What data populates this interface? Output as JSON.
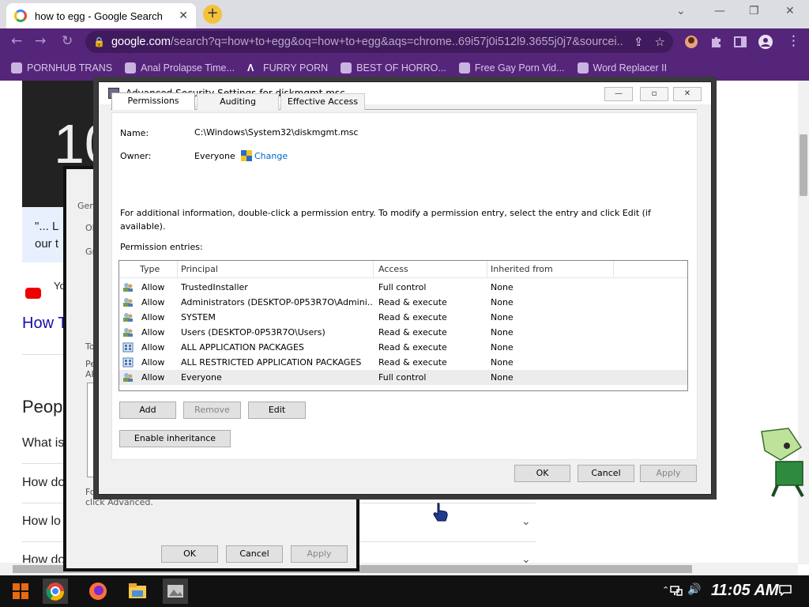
{
  "browser": {
    "tab_title": "how to egg - Google Search",
    "url_host": "google.com",
    "url_rest": "/search?q=how+to+egg&oq=how+to+egg&aqs=chrome..69i57j0i512l9.3655j0j7&sourcei...",
    "bookmarks": [
      "PORNHUB TRANS",
      "Anal Prolapse Time...",
      "FURRY PORN",
      "BEST OF HORRO...",
      "Free Gay Porn Vid...",
      "Word Replacer II"
    ]
  },
  "page": {
    "video_text": "10",
    "quote": "\"... L",
    "quote2": "our t",
    "yt_text": "Yo",
    "link": "How T",
    "people_heading": "Peop",
    "questions": [
      "What is",
      "How do",
      "How lo",
      "How do"
    ]
  },
  "bg_dialog": {
    "ghost_lines": [
      "Gen",
      "Ob",
      "Gro",
      "To",
      "Pe",
      "AP",
      "For",
      "click Advanced."
    ],
    "ok": "OK",
    "cancel": "Cancel",
    "apply": "Apply"
  },
  "adv": {
    "title": "Advanced Security Settings for diskmgmt.msc",
    "name_label": "Name:",
    "name_value": "C:\\Windows\\System32\\diskmgmt.msc",
    "owner_label": "Owner:",
    "owner_value": "Everyone",
    "change_link": "Change",
    "tabs": [
      "Permissions",
      "Auditing",
      "Effective Access"
    ],
    "info": "For additional information, double-click a permission entry. To modify a permission entry, select the entry and click Edit (if available).",
    "entries_label": "Permission entries:",
    "columns": [
      "Type",
      "Principal",
      "Access",
      "Inherited from"
    ],
    "rows": [
      {
        "type": "Allow",
        "principal": "TrustedInstaller",
        "access": "Full control",
        "inherited": "None"
      },
      {
        "type": "Allow",
        "principal": "Administrators (DESKTOP-0P53R7O\\Admini...",
        "access": "Read & execute",
        "inherited": "None"
      },
      {
        "type": "Allow",
        "principal": "SYSTEM",
        "access": "Read & execute",
        "inherited": "None"
      },
      {
        "type": "Allow",
        "principal": "Users (DESKTOP-0P53R7O\\Users)",
        "access": "Read & execute",
        "inherited": "None"
      },
      {
        "type": "Allow",
        "principal": "ALL APPLICATION PACKAGES",
        "access": "Read & execute",
        "inherited": "None"
      },
      {
        "type": "Allow",
        "principal": "ALL RESTRICTED APPLICATION PACKAGES",
        "access": "Read & execute",
        "inherited": "None"
      },
      {
        "type": "Allow",
        "principal": "Everyone",
        "access": "Full control",
        "inherited": "None"
      }
    ],
    "add": "Add",
    "remove": "Remove",
    "edit": "Edit",
    "enable_inheritance": "Enable inheritance",
    "ok": "OK",
    "cancel": "Cancel",
    "apply": "Apply"
  },
  "taskbar": {
    "clock": "11:05 AM"
  },
  "colors": {
    "chrome_purple": "#55257a",
    "omnibox": "#3f1a5c"
  }
}
